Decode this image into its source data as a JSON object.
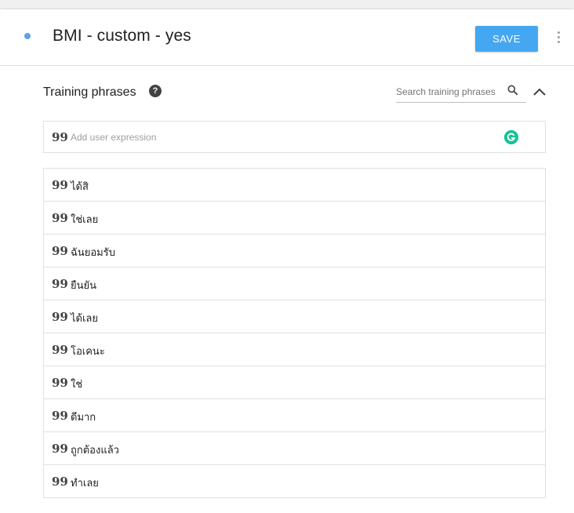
{
  "header": {
    "title": "BMI - custom - yes",
    "save_label": "SAVE",
    "accent_color": "#45a7f1"
  },
  "training": {
    "section_title": "Training phrases",
    "help_icon": "help-circle-icon",
    "search_placeholder": "Search training phrases",
    "add_placeholder": "Add user expression",
    "quote_glyph": "99",
    "phrases": [
      "ได้สิ",
      "ใช่เลย",
      "ฉันยอมรับ",
      "ยืนยัน",
      "ได้เลย",
      "โอเคนะ",
      "ใช่",
      "ดีมาก",
      "ถูกต้องแล้ว",
      "ทำเลย"
    ]
  }
}
